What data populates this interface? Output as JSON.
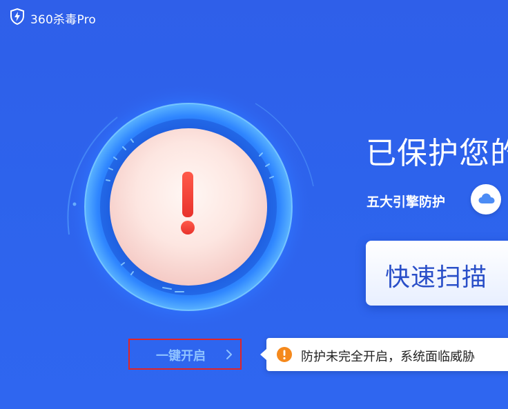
{
  "app": {
    "title": "360杀毒Pro",
    "logo_icon": "shield-lightning-icon"
  },
  "status": {
    "headline": "已保护您的",
    "engines_label": "五大引擎防护",
    "engine_icon": "cloud-icon",
    "alert_icon": "exclamation-icon"
  },
  "actions": {
    "scan_label": "快速扫描",
    "enable_label": "一键开启",
    "enable_icon": "chevron-right-icon"
  },
  "warning": {
    "icon": "warning-icon",
    "text": "防护未完全开启，系统面临威胁"
  },
  "colors": {
    "background": "#2f5fe9",
    "scan_text": "#2a4fc8",
    "enable_text": "#8fc3ff",
    "alert_red": "#f2403a",
    "warning_orange": "#f5891c",
    "highlight_border": "#e32424"
  }
}
